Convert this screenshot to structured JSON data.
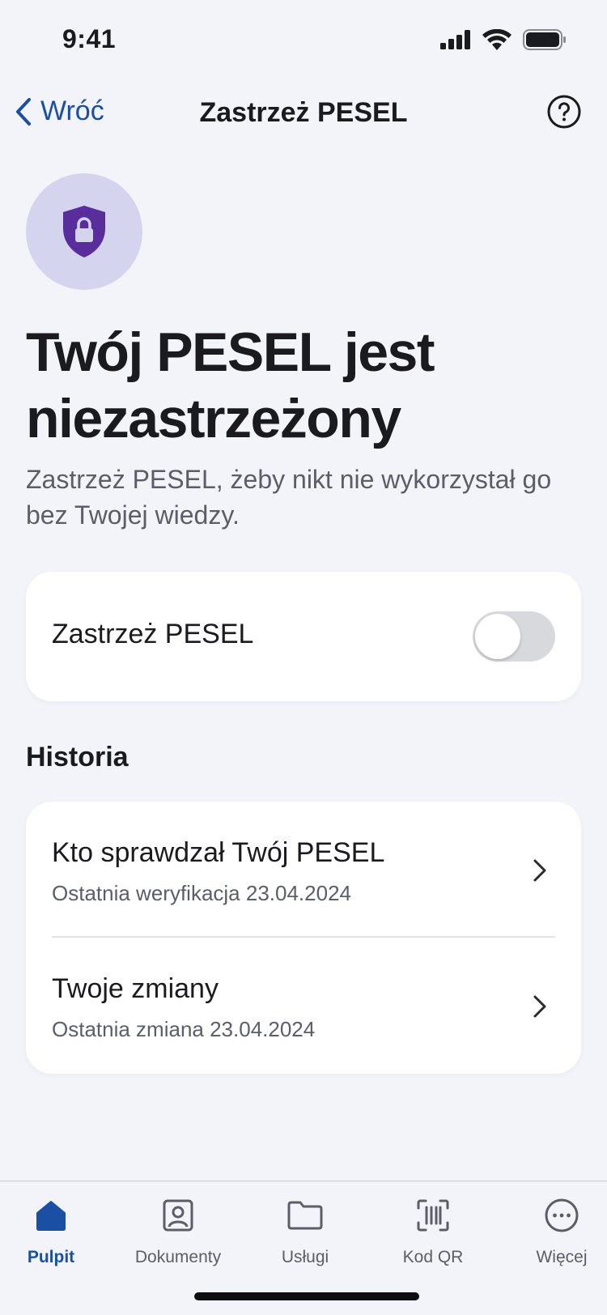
{
  "status_bar": {
    "time": "9:41",
    "icons": [
      "signal-icon",
      "wifi-icon",
      "battery-icon"
    ]
  },
  "nav": {
    "back_label": "Wróć",
    "title": "Zastrzeż PESEL",
    "help_icon": "help-icon"
  },
  "hero": {
    "icon": "shield-lock-icon",
    "title": "Twój PESEL jest niezastrzeżony",
    "subtitle": "Zastrzeż PESEL, żeby nikt nie wykorzystał go bez Twojej wiedzy."
  },
  "toggle_card": {
    "label": "Zastrzeż PESEL",
    "toggle_on": false
  },
  "history": {
    "heading": "Historia",
    "items": [
      {
        "title": "Kto sprawdzał Twój PESEL",
        "subtitle": "Ostatnia weryfikacja 23.04.2024"
      },
      {
        "title": "Twoje zmiany",
        "subtitle": "Ostatnia zmiana 23.04.2024"
      }
    ]
  },
  "tabs": [
    {
      "label": "Pulpit",
      "icon": "home-icon",
      "active": true
    },
    {
      "label": "Dokumenty",
      "icon": "id-card-icon",
      "active": false
    },
    {
      "label": "Usługi",
      "icon": "folder-icon",
      "active": false
    },
    {
      "label": "Kod QR",
      "icon": "qr-scan-icon",
      "active": false
    },
    {
      "label": "Więcej",
      "icon": "more-icon",
      "active": false
    }
  ],
  "colors": {
    "accent": "#1a4fa3",
    "background": "#f3f4f9",
    "shield": "#5a2d9c",
    "shield_bg": "#d5d4ef"
  }
}
